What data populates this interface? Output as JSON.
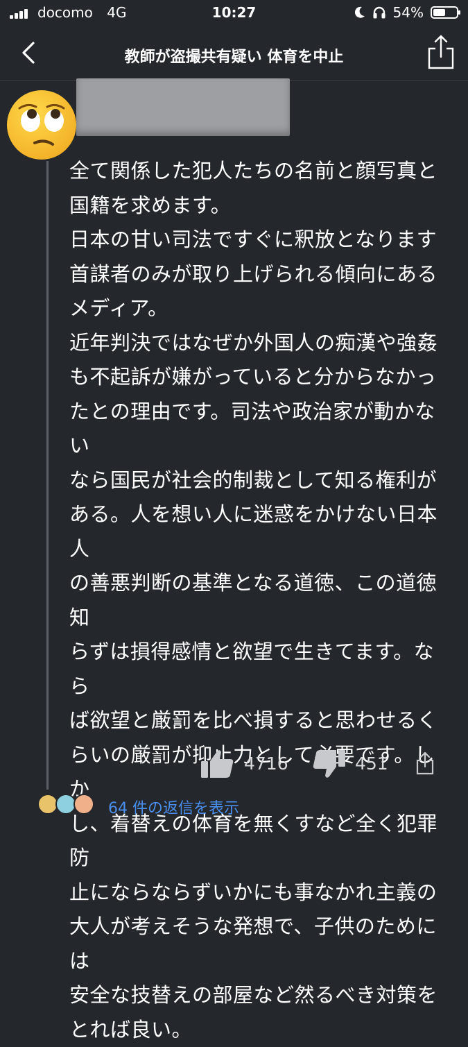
{
  "status_bar": {
    "carrier": "docomo",
    "network": "4G",
    "time": "10:27",
    "battery": "54%",
    "battery_level": 0.54
  },
  "nav": {
    "title": "教師が盗撮共有疑い 体育を中止",
    "back_icon": "chevron-left-icon",
    "share_icon": "share-icon"
  },
  "comment": {
    "avatar": "face-with-rolling-eyes-emoji",
    "lines": [
      "全て関係した犯人たちの名前と顔写真と",
      "国籍を求めます。",
      "日本の甘い司法ですぐに釈放となります",
      "首謀者のみが取り上げられる傾向にある",
      "メディア。",
      "近年判決ではなぜか外国人の痴漢や強姦",
      "も不起訴が嫌がっていると分からなかっ",
      "たとの理由です。司法や政治家が動かない",
      "なら国民が社会的制裁として知る権利が",
      "ある。人を想い人に迷惑をかけない日本人",
      "の善悪判断の基準となる道徳、この道徳知",
      "らずは損得感情と欲望で生きてます。なら",
      "ば欲望と厳罰を比べ損すると思わせるく",
      "らいの厳罰が抑止力として必要です。しか",
      "し、着替えの体育を無くすなど全く犯罪防",
      "止にならならずいかにも事なかれ主義の",
      "大人が考えそうな発想で、子供のためには",
      "安全な技替えの部屋など然るべき対策を",
      "とれば良い。"
    ],
    "likes": "4716",
    "dislikes": "451",
    "replies_label": "64 件の返信を表示"
  },
  "colors": {
    "background": "#24272b",
    "link": "#4a8ff0",
    "text": "#ffffff",
    "muted": "#d8d9db"
  }
}
